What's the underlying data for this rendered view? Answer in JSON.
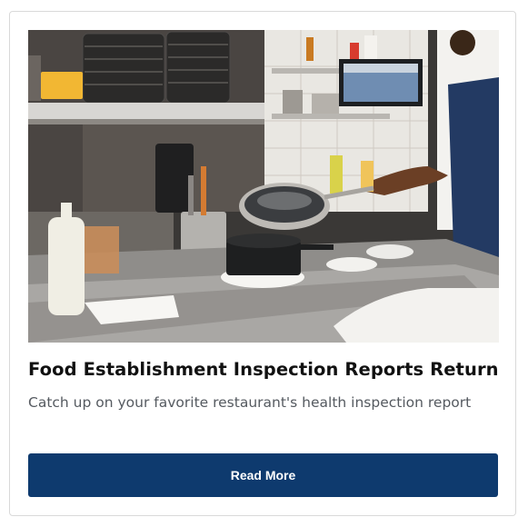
{
  "card": {
    "title": "Food Establishment Inspection Reports Return",
    "description": "Catch up on your favorite restaurant's health inspection report",
    "button_label": "Read More",
    "image_alt": "Chef cooking in a restaurant kitchen",
    "button_color": "#0e3a6e"
  }
}
